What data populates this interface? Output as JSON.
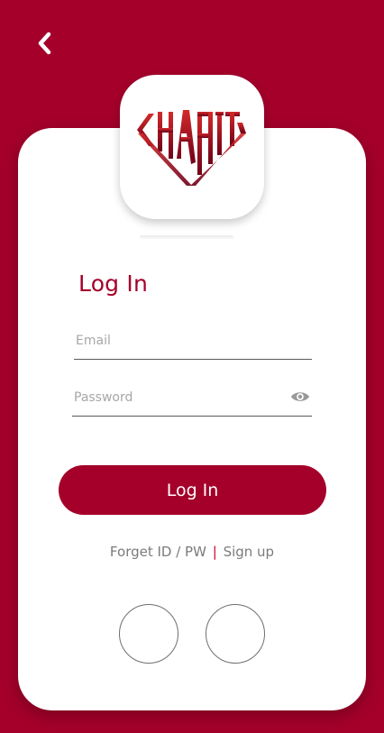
{
  "logo": {
    "text": "CHABIT",
    "colors": {
      "gradient_top": "#d32a2a",
      "gradient_bottom": "#6e0019"
    }
  },
  "form": {
    "title": "Log In",
    "email_placeholder": "Email",
    "password_placeholder": "Password",
    "submit_label": "Log In"
  },
  "links": {
    "forget": "Forget ID / PW",
    "separator": "|",
    "signup": "Sign up"
  },
  "icons": {
    "back": "chevron-left-icon",
    "password_toggle": "eye-icon"
  },
  "colors": {
    "primary": "#a4002a",
    "card": "#ffffff",
    "muted_text": "#7b7b7b",
    "separator": "#d1002b"
  }
}
